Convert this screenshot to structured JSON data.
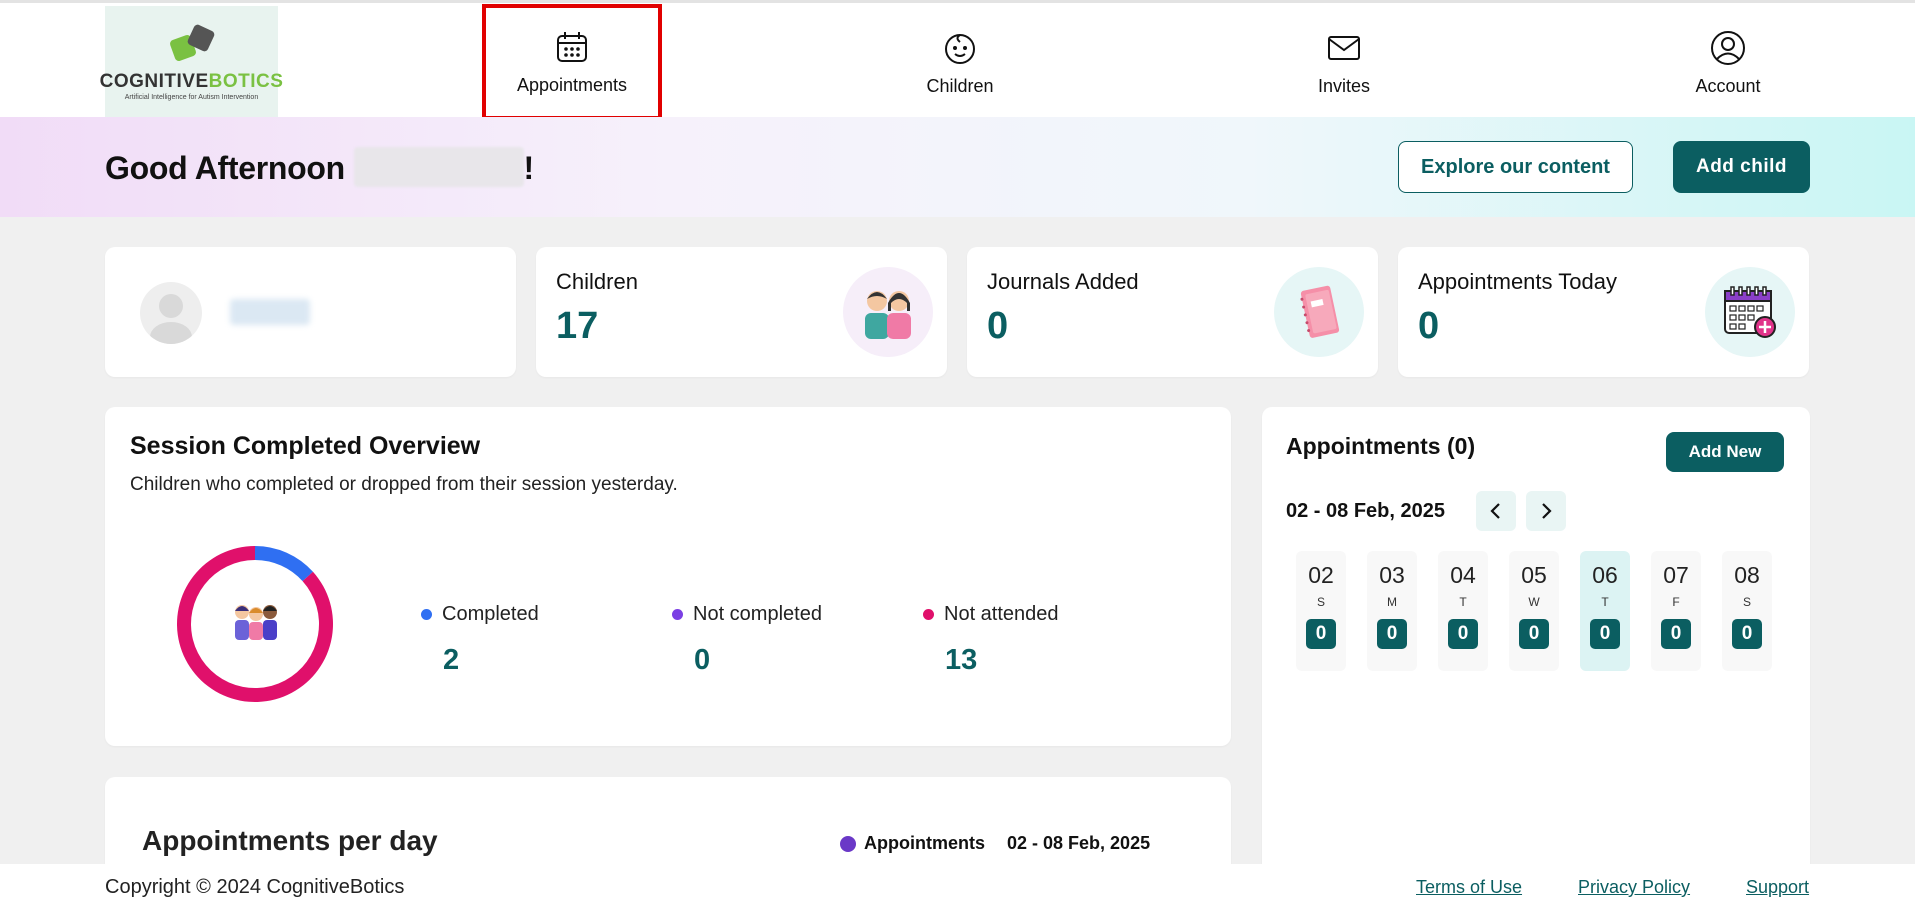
{
  "logo": {
    "name_part1": "COGNITIVE",
    "name_part2": "BOTICS",
    "tagline": "Artificial Intelligence for Autism Intervention"
  },
  "nav": [
    {
      "label": "Appointments",
      "icon": "calendar-icon",
      "selected": true
    },
    {
      "label": "Children",
      "icon": "baby-face-icon"
    },
    {
      "label": "Invites",
      "icon": "envelope-icon"
    },
    {
      "label": "Account",
      "icon": "user-circle-icon"
    }
  ],
  "banner": {
    "greeting": "Good Afternoon",
    "greeting_suffix": "!",
    "explore_label": "Explore our content",
    "add_child_label": "Add child"
  },
  "stats": {
    "children": {
      "label": "Children",
      "value": "17",
      "icon": "two-kids-icon"
    },
    "journals": {
      "label": "Journals Added",
      "value": "0",
      "icon": "notebook-icon"
    },
    "appointments_today": {
      "label": "Appointments Today",
      "value": "0",
      "icon": "calendar-add-icon"
    }
  },
  "overview": {
    "title": "Session Completed Overview",
    "subtitle": "Children who completed or dropped from their session yesterday.",
    "legend": [
      {
        "label": "Completed",
        "value": "2",
        "color": "#2f6ff2"
      },
      {
        "label": "Not completed",
        "value": "0",
        "color": "#7b3fe4"
      },
      {
        "label": "Not attended",
        "value": "13",
        "color": "#e0106b"
      }
    ],
    "donut_values": {
      "completed": 2,
      "not_completed": 0,
      "not_attended": 13
    }
  },
  "per_day": {
    "title": "Appointments per day",
    "legend_label": "Appointments",
    "legend_color": "#6a38c7",
    "range": "02 - 08 Feb, 2025"
  },
  "appointments_panel": {
    "title": "Appointments (0)",
    "add_label": "Add New",
    "range": "02 - 08 Feb, 2025",
    "prev_icon": "chevron-left-icon",
    "next_icon": "chevron-right-icon",
    "days": [
      {
        "num": "02",
        "weekday": "S",
        "count": "0"
      },
      {
        "num": "03",
        "weekday": "M",
        "count": "0"
      },
      {
        "num": "04",
        "weekday": "T",
        "count": "0"
      },
      {
        "num": "05",
        "weekday": "W",
        "count": "0"
      },
      {
        "num": "06",
        "weekday": "T",
        "count": "0",
        "active": true
      },
      {
        "num": "07",
        "weekday": "F",
        "count": "0"
      },
      {
        "num": "08",
        "weekday": "S",
        "count": "0"
      }
    ]
  },
  "footer": {
    "copyright": "Copyright © 2024 CognitiveBotics",
    "links": [
      "Terms of Use",
      "Privacy Policy",
      "Support"
    ]
  },
  "colors": {
    "brand": "#0b5e61",
    "highlight": "#e10000"
  }
}
